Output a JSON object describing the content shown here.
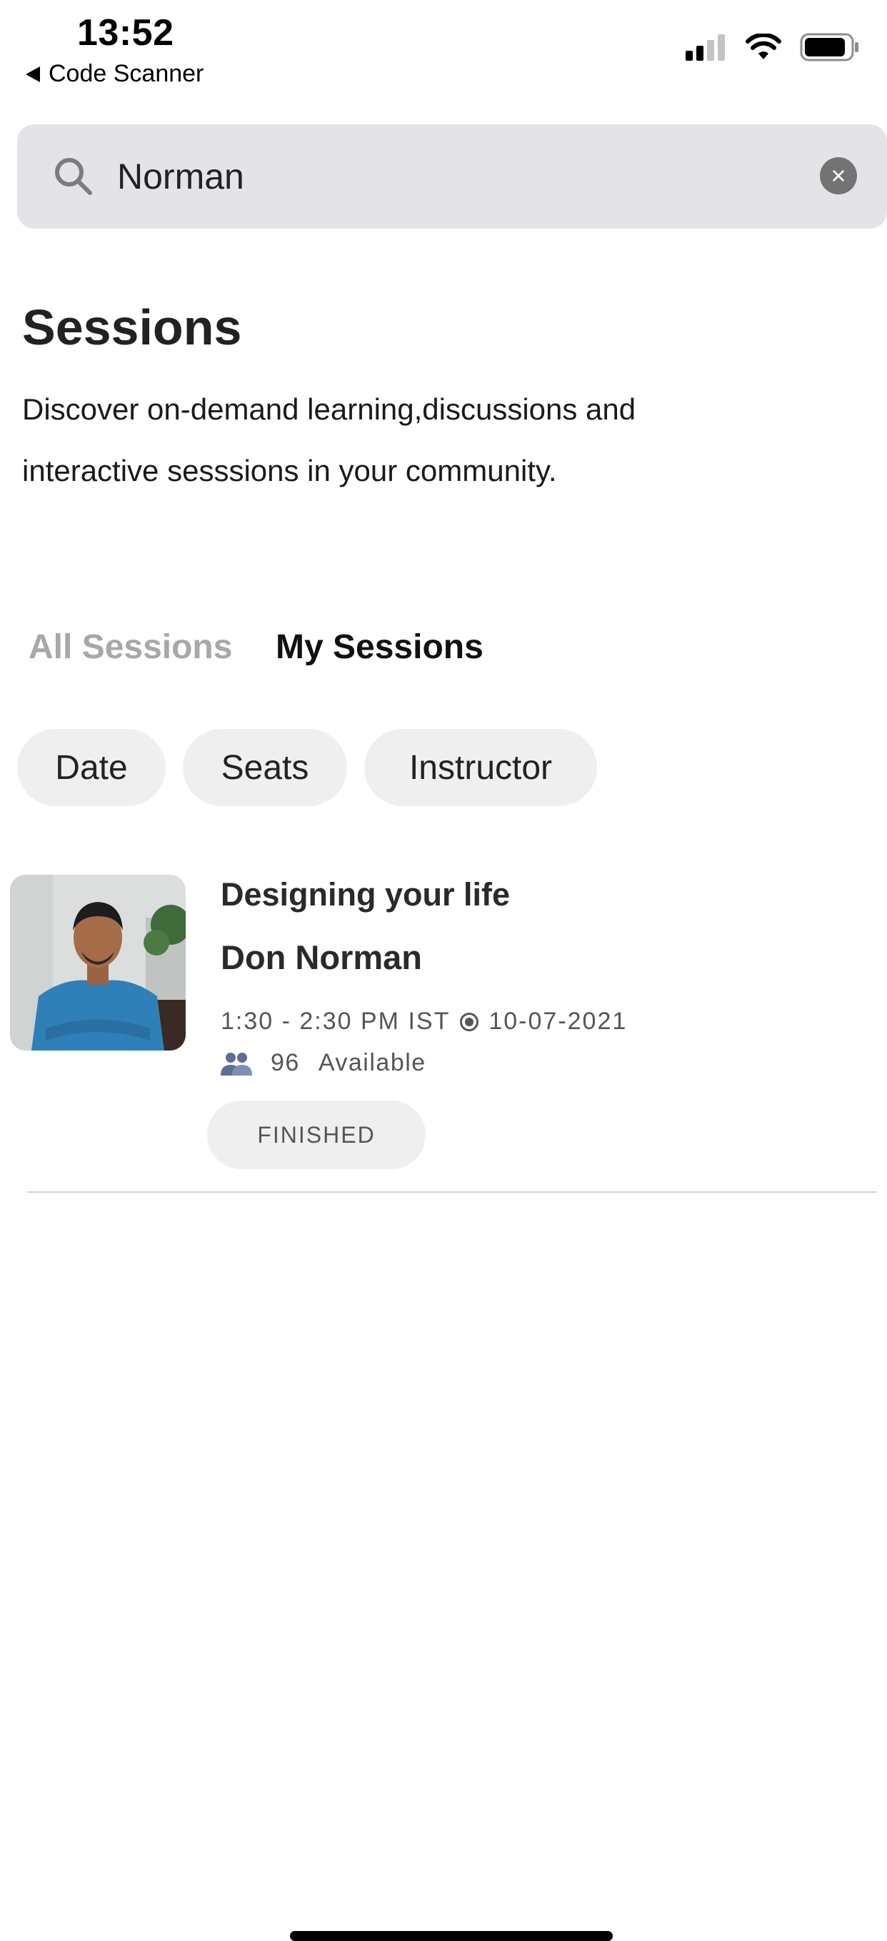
{
  "status_bar": {
    "time": "13:52",
    "back_label": "Code Scanner",
    "icons": [
      "cellular-signal-icon",
      "wifi-icon",
      "battery-icon"
    ]
  },
  "search": {
    "value": "Norman",
    "placeholder": ""
  },
  "header": {
    "title": "Sessions",
    "description": "Discover on-demand learning,discussions and interactive sesssions in your community."
  },
  "tabs": [
    {
      "label": "All Sessions",
      "active": false
    },
    {
      "label": "My Sessions",
      "active": true
    }
  ],
  "filters": [
    {
      "label": "Date"
    },
    {
      "label": "Seats"
    },
    {
      "label": "Instructor"
    }
  ],
  "sessions": [
    {
      "title": "Designing your life",
      "instructor": "Don Norman",
      "time": "1:30 - 2:30 PM IST",
      "date": "10-07-2021",
      "seats": "96",
      "seats_label": "Available",
      "status": "FINISHED"
    }
  ],
  "colors": {
    "search_bg": "#e3e3e8",
    "chip_bg": "#efefef",
    "inactive_tab": "#a8a8a8",
    "people_icon": "#5a6e96"
  }
}
